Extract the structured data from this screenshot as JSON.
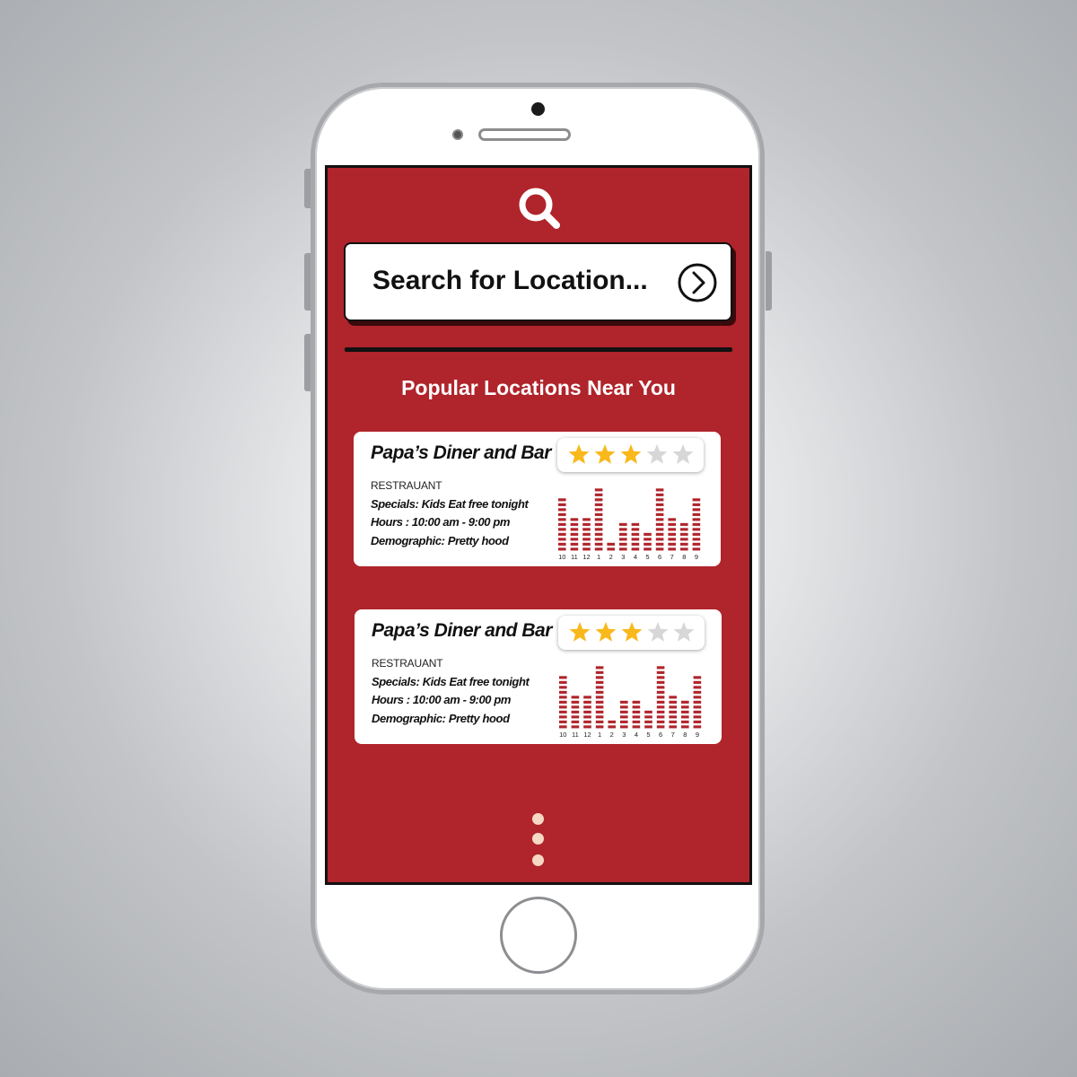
{
  "colors": {
    "screen_background": "#b0242b",
    "bar_color": "#b0242b",
    "star_filled": "#f9b81b",
    "star_empty": "#d7d7d7",
    "dot_color": "#f6d8c5"
  },
  "header": {
    "icon": "search-icon"
  },
  "search": {
    "placeholder": "Search for Location...",
    "go_icon": "chevron-right-circle-icon"
  },
  "section": {
    "title": "Popular Locations Near You"
  },
  "locations": [
    {
      "name": "Papa’s Diner and Bar",
      "type": "RESTRAUANT",
      "specials": "Specials: Kids Eat free tonight",
      "hours": "Hours : 10:00 am - 9:00 pm",
      "demographic": "Demographic: Pretty hood",
      "rating": 3,
      "rating_max": 5
    },
    {
      "name": "Papa’s Diner and Bar",
      "type": "RESTRAUANT",
      "specials": "Specials: Kids Eat free tonight",
      "hours": "Hours : 10:00 am - 9:00 pm",
      "demographic": "Demographic: Pretty hood",
      "rating": 3,
      "rating_max": 5
    }
  ],
  "chart_data": [
    {
      "type": "bar",
      "categories": [
        "10",
        "11",
        "12",
        "1",
        "2",
        "3",
        "4",
        "5",
        "6",
        "7",
        "8",
        "9"
      ],
      "values": [
        6,
        4,
        4,
        7,
        1,
        3,
        3,
        2,
        7,
        4,
        3,
        6
      ],
      "ylim": [
        0,
        7
      ]
    },
    {
      "type": "bar",
      "categories": [
        "10",
        "11",
        "12",
        "1",
        "2",
        "3",
        "4",
        "5",
        "6",
        "7",
        "8",
        "9"
      ],
      "values": [
        6,
        4,
        4,
        7,
        1,
        3,
        3,
        2,
        7,
        4,
        3,
        6
      ],
      "ylim": [
        0,
        7
      ]
    }
  ],
  "more_menu": {
    "icon": "more-vertical-icon"
  }
}
